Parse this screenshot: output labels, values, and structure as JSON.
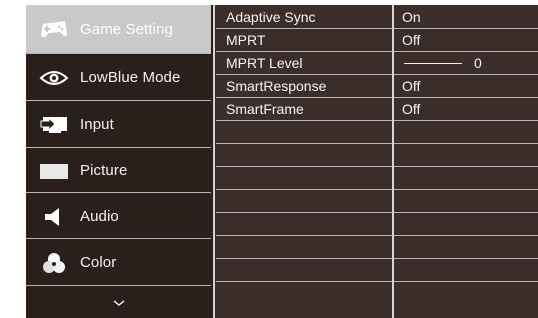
{
  "menu": {
    "items": [
      {
        "label": "Game Setting",
        "icon": "gamepad-icon",
        "selected": true
      },
      {
        "label": "LowBlue Mode",
        "icon": "eye-icon",
        "selected": false
      },
      {
        "label": "Input",
        "icon": "input-icon",
        "selected": false
      },
      {
        "label": "Picture",
        "icon": "picture-icon",
        "selected": false
      },
      {
        "label": "Audio",
        "icon": "speaker-icon",
        "selected": false
      },
      {
        "label": "Color",
        "icon": "color-icon",
        "selected": false
      }
    ],
    "more_icon": "chevron-down-icon"
  },
  "settings": [
    {
      "label": "Adaptive Sync",
      "value": "On"
    },
    {
      "label": "MPRT",
      "value": "Off"
    },
    {
      "label": "MPRT Level",
      "value": "0",
      "slider_level": 0
    },
    {
      "label": "SmartResponse",
      "value": "Off"
    },
    {
      "label": "SmartFrame",
      "value": "Off"
    }
  ],
  "colors": {
    "panel_bg": "#3a2d2a",
    "menu_bg": "#2b1f1c",
    "selected_bg": "#c9c9c9",
    "separator": "#b9b2b0"
  }
}
